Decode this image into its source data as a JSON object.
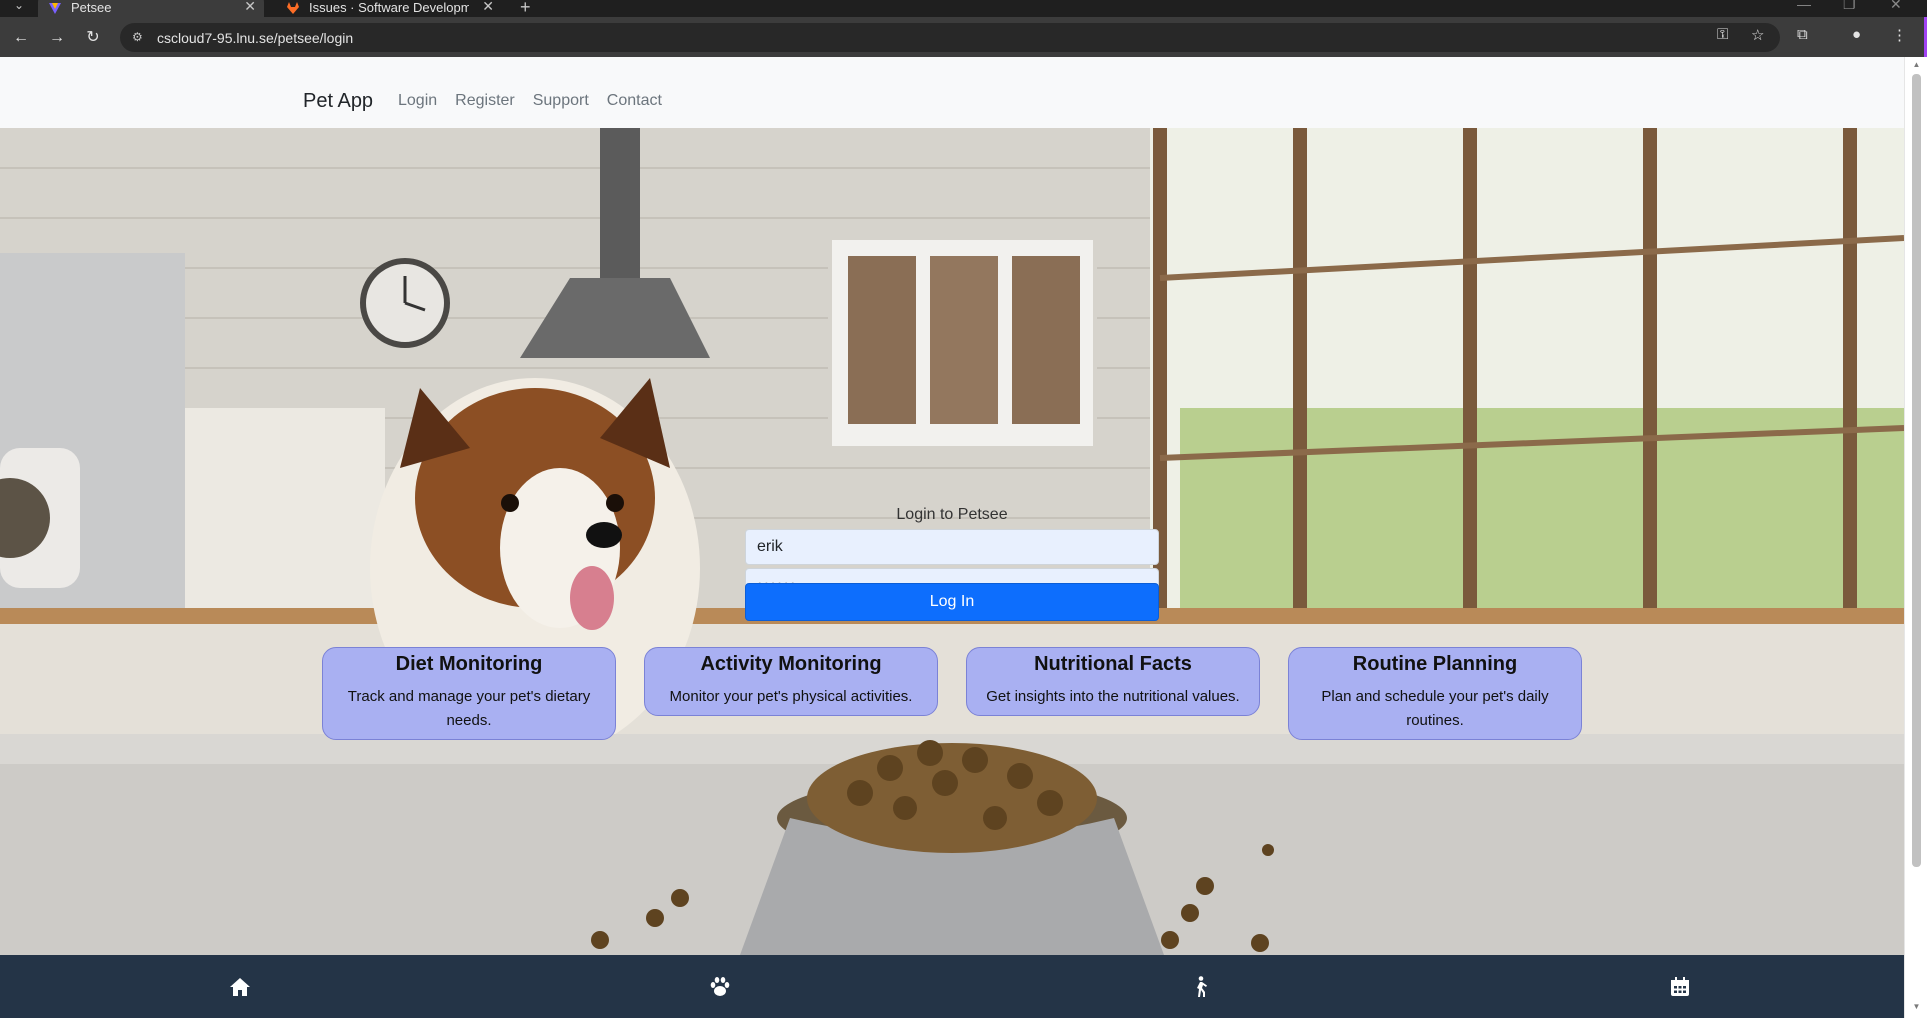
{
  "browser": {
    "tabs": [
      {
        "title": "Petsee",
        "active": true
      },
      {
        "title": "Issues · Software Development",
        "active": false
      }
    ],
    "url": "cscloud7-95.lnu.se/petsee/login"
  },
  "navbar": {
    "brand": "Pet App",
    "links": [
      "Login",
      "Register",
      "Support",
      "Contact"
    ]
  },
  "login": {
    "title": "Login to Petsee",
    "username_value": "erik",
    "password_value": "••••••",
    "button_label": "Log In"
  },
  "features": [
    {
      "title": "Diet Monitoring",
      "description": "Track and manage your pet's dietary needs."
    },
    {
      "title": "Activity Monitoring",
      "description": "Monitor your pet's physical activities."
    },
    {
      "title": "Nutritional Facts",
      "description": "Get insights into the nutritional values."
    },
    {
      "title": "Routine Planning",
      "description": "Plan and schedule your pet's daily routines."
    }
  ],
  "footer": {
    "icons": [
      "home-icon",
      "paw-icon",
      "walking-icon",
      "calendar-icon"
    ]
  },
  "colors": {
    "accent": "#0d6efd",
    "card_bg": "#a9b0f2",
    "footer_bg": "#243447",
    "navbar_bg": "#f8f9fa"
  }
}
